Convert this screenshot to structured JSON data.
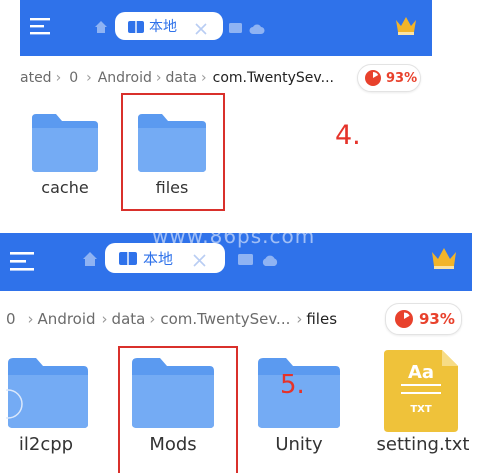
{
  "top": {
    "tab_label": "本地",
    "breadcrumb": [
      "ated",
      "0",
      "Android",
      "data",
      "com.TwentySev..."
    ],
    "storage_pct": "93%",
    "folders": [
      {
        "label": "cache"
      },
      {
        "label": "files"
      }
    ],
    "step_label": "4."
  },
  "bottom": {
    "tab_label": "本地",
    "watermark": "www.86ps.com",
    "breadcrumb": [
      "0",
      "Android",
      "data",
      "com.TwentySev...",
      "files"
    ],
    "storage_pct": "93%",
    "items": [
      {
        "label": "il2cpp",
        "icon": "folder-icon"
      },
      {
        "label": "Mods",
        "icon": "folder-icon"
      },
      {
        "label": "Unity",
        "icon": "folder-icon"
      },
      {
        "label": "setting.txt",
        "icon": "txt-file-icon"
      }
    ],
    "txt_icon_text": {
      "top": "Aa",
      "bottom": "TXT"
    },
    "step_label": "5."
  },
  "colors": {
    "accent": "#2f72ea",
    "folder": "#5b9af0",
    "highlight": "#d9302b",
    "crown": "#f2b42a"
  }
}
